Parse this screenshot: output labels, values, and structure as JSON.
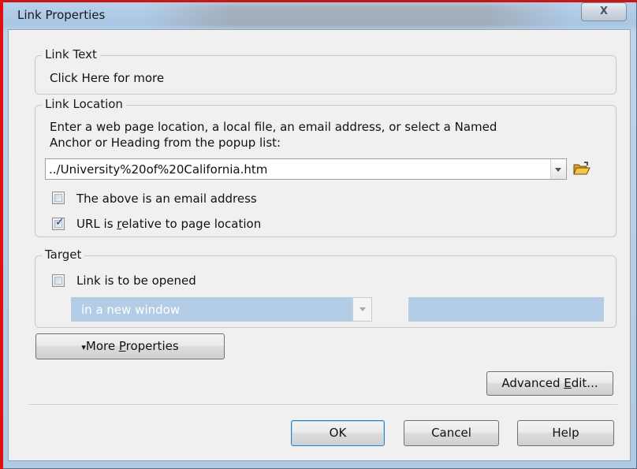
{
  "window": {
    "title": "Link Properties",
    "close_glyph": "X"
  },
  "link_text": {
    "legend": "Link Text",
    "value": "Click Here for more"
  },
  "link_location": {
    "legend": "Link Location",
    "instruction_line1": "Enter a web page location, a local file, an email address, or select a Named",
    "instruction_line2": "Anchor or Heading from the popup list:",
    "url_value": "../University%20of%20California.htm",
    "email_checkbox": {
      "label": "The above is an email address",
      "checked": false
    },
    "relative_checkbox": {
      "label_pre": "URL is ",
      "label_u": "r",
      "label_post": "elative to page location",
      "checked": true
    },
    "browse_icon": "open-folder-icon"
  },
  "target": {
    "legend": "Target",
    "open_checkbox": {
      "label": "Link is to be opened",
      "checked": false
    },
    "window_select": "in a new window",
    "frame_field": ""
  },
  "more_properties": {
    "prefix_glyph": "▾",
    "label_pre": "More ",
    "label_u": "P",
    "label_post": "roperties"
  },
  "advanced_edit": {
    "label_pre": "Advanced ",
    "label_u": "E",
    "label_post": "dit..."
  },
  "footer": {
    "ok": "OK",
    "cancel": "Cancel",
    "help": "Help"
  }
}
